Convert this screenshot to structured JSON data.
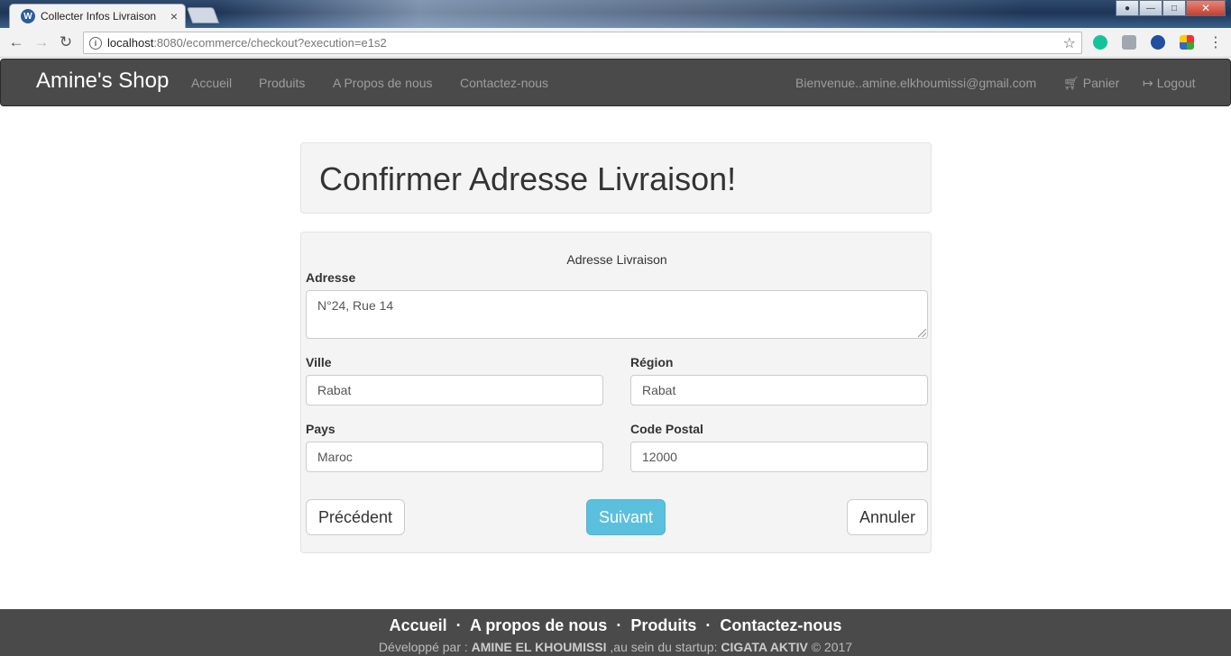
{
  "browser": {
    "tab_title": "Collecter Infos Livraison",
    "tab_close": "×",
    "url_host": "localhost",
    "url_rest": ":8080/ecommerce/checkout?execution=e1s2"
  },
  "navbar": {
    "brand": "Amine's Shop",
    "links": [
      "Accueil",
      "Produits",
      "A Propos de nous",
      "Contactez-nous"
    ],
    "welcome": "Bienvenue..amine.elkhoumissi@gmail.com",
    "cart": "Panier",
    "logout": "Logout"
  },
  "page": {
    "title": "Confirmer Adresse Livraison!"
  },
  "form": {
    "legend": "Adresse Livraison",
    "adresse_label": "Adresse",
    "adresse_value": "N°24, Rue 14",
    "ville_label": "Ville",
    "ville_value": "Rabat",
    "region_label": "Région",
    "region_value": "Rabat",
    "pays_label": "Pays",
    "pays_value": "Maroc",
    "code_label": "Code Postal",
    "code_value": "12000",
    "prev_button": "Précédent",
    "next_button": "Suivant",
    "cancel_button": "Annuler"
  },
  "footer": {
    "links": [
      "Accueil",
      "A propos de nous",
      "Produits",
      "Contactez-nous"
    ],
    "separator": "·",
    "credit_prefix": "Développé par : ",
    "credit_author": "AMINE EL KHOUMISSI",
    "credit_middle": " ,au sein du startup: ",
    "credit_company": "CIGATA AKTIV",
    "credit_suffix": " © 2017"
  },
  "colors": {
    "navbar_bg": "#4a4a4a",
    "accent_info": "#5bc0de",
    "well_bg": "#f4f4f4"
  }
}
